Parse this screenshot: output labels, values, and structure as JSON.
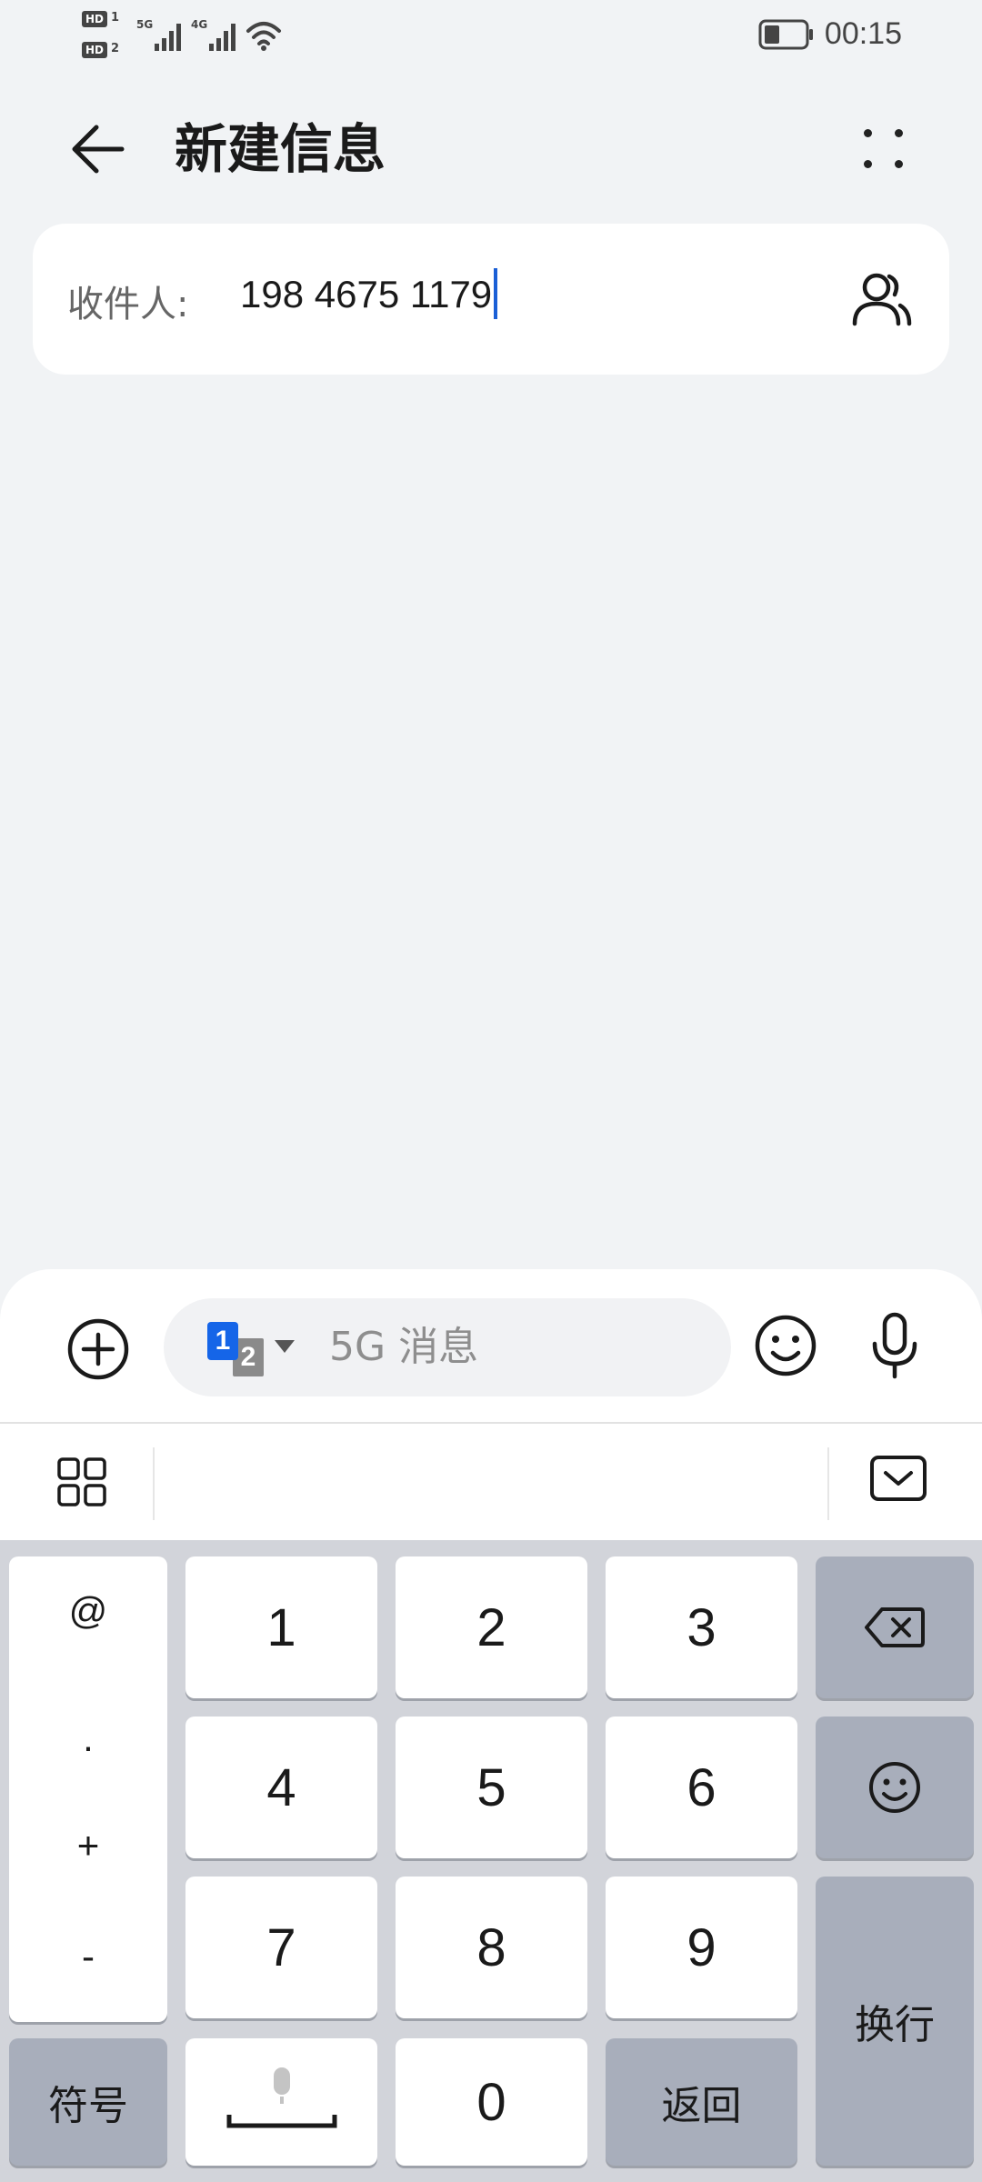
{
  "status_bar": {
    "time": "00:15",
    "sim1_badge": "HD",
    "sim1_num": "1",
    "sim2_badge": "HD",
    "sim2_num": "2",
    "sim1_network": "5G",
    "sim2_network": "4G",
    "icons": [
      "signal-icon",
      "signal-icon",
      "wifi-icon",
      "battery-icon"
    ]
  },
  "header": {
    "title": "新建信息"
  },
  "recipient": {
    "label": "收件人:",
    "value": "198 4675 1179"
  },
  "compose": {
    "placeholder": "5G 消息",
    "sim_primary": "1",
    "sim_secondary": "2"
  },
  "keyboard": {
    "symbols": [
      "@",
      ".",
      "+",
      "-"
    ],
    "digits": [
      "1",
      "2",
      "3",
      "4",
      "5",
      "6",
      "7",
      "8",
      "9",
      "0"
    ],
    "symbol_key": "符号",
    "return_key": "返回",
    "newline_key": "换行"
  },
  "colors": {
    "accent": "#1565e8",
    "caret": "#1a5fd6",
    "background": "#f1f3f5",
    "keyboard_bg": "#d2d4da",
    "function_key": "#a8aebb"
  }
}
